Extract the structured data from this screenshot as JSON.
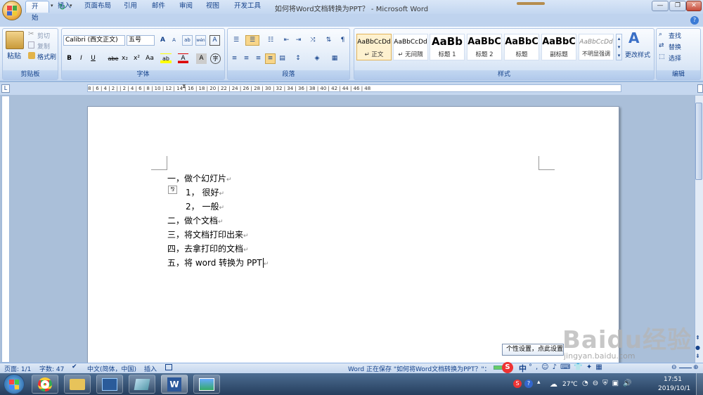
{
  "window": {
    "title": "如何将Word文档转换为PPT？ - Microsoft Word"
  },
  "tabs": [
    "开始",
    "插入",
    "页面布局",
    "引用",
    "邮件",
    "审阅",
    "视图",
    "开发工具"
  ],
  "clipboard": {
    "paste": "粘贴",
    "cut": "剪切",
    "copy": "复制",
    "format_painter": "格式刷",
    "label": "剪贴板"
  },
  "font": {
    "name": "Calibri (西文正文)",
    "size": "五号",
    "label": "字体",
    "grow": "A",
    "shrink": "A",
    "bold": "B",
    "italic": "I",
    "underline": "U",
    "strike": "abe",
    "sub": "x₂",
    "sup": "x²",
    "case": "Aa",
    "highlight": "ab",
    "color": "A",
    "charshade": "A",
    "phonetic": "wén",
    "border": "A",
    "enclose": "字"
  },
  "paragraph": {
    "label": "段落"
  },
  "styles": {
    "label": "样式",
    "change": "更改样式",
    "items": [
      {
        "sample": "AaBbCcDd",
        "name": "↵ 正文"
      },
      {
        "sample": "AaBbCcDd",
        "name": "↵ 无间隔"
      },
      {
        "sample": "AaBb",
        "name": "标题 1"
      },
      {
        "sample": "AaBbC",
        "name": "标题 2"
      },
      {
        "sample": "AaBbC",
        "name": "标题"
      },
      {
        "sample": "AaBbC",
        "name": "副标题"
      },
      {
        "sample": "AaBbCcDd",
        "name": "不明显强调"
      }
    ]
  },
  "editing": {
    "find": "查找",
    "replace": "替换",
    "select": "选择",
    "label": "编辑"
  },
  "ruler": {
    "ticks": "8  |  6  |  4  |  2  |  | 2 |  4  |  6  |  8  |  10  |  12  |  14  |  16  |  18  |  20  |  22  |  24  |  26  |  28  |  30  |  32  |  34  |  36  |  38  |  40  |  42  |  44  |  46  |  48"
  },
  "document": {
    "lines": [
      {
        "text": "一，做个幻灯片",
        "indent": 0
      },
      {
        "text": "1， 很好",
        "indent": 26
      },
      {
        "text": "2， 一般",
        "indent": 26
      },
      {
        "text": "二，做个文档",
        "indent": 0
      },
      {
        "text": "三，将文档打印出来",
        "indent": 0
      },
      {
        "text": "四，去拿打印的文档",
        "indent": 0
      },
      {
        "text": "五，将 word 转换为 PPT",
        "indent": 0
      }
    ]
  },
  "status": {
    "page": "页面: 1/1",
    "words": "字数: 47",
    "lang": "中文(简体，中国)",
    "mode": "插入",
    "saving": "Word 正在保存 \"如何将Word文档转换为PPT？\"："
  },
  "tooltip": {
    "text": "个性设置，点此设置"
  },
  "taskbar": {
    "weather": "27℃",
    "time": "17:51",
    "date": "2019/10/1",
    "ime": "中"
  },
  "watermark": {
    "brand": "Baidu经验",
    "url": "jingyan.baidu.com"
  }
}
